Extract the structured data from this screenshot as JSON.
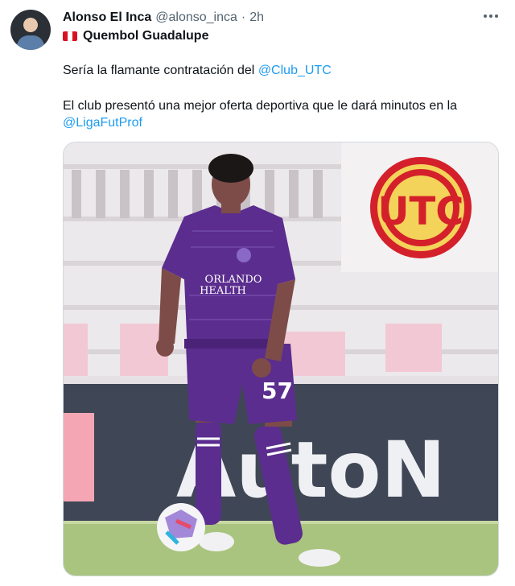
{
  "tweet": {
    "display_name": "Alonso El Inca",
    "handle": "@alonso_inca",
    "separator": "·",
    "time": "2h",
    "community": "Quembol Guadalupe",
    "line1_text": "Sería la flamante contratación del ",
    "line1_mention": "@Club_UTC",
    "line2_text": "El club presentó una mejor oferta deportiva que le dará minutos en la",
    "line3_mention": "@LigaFutProf"
  },
  "image": {
    "shirt_sponsor_line1": "ORLANDO",
    "shirt_sponsor_line2": "HEALTH",
    "shorts_number": "57",
    "board_text": "AutoN",
    "logo_text": "UTC",
    "colors": {
      "kit_purple": "#5b2d8e",
      "logo_red": "#d4202a",
      "logo_yellow": "#f3d35a",
      "pitch_green": "#a9c47e",
      "ad_board": "#3f4655"
    }
  },
  "icons": {
    "more": "more-horizontal-icon",
    "flag": "peru-flag-icon"
  }
}
